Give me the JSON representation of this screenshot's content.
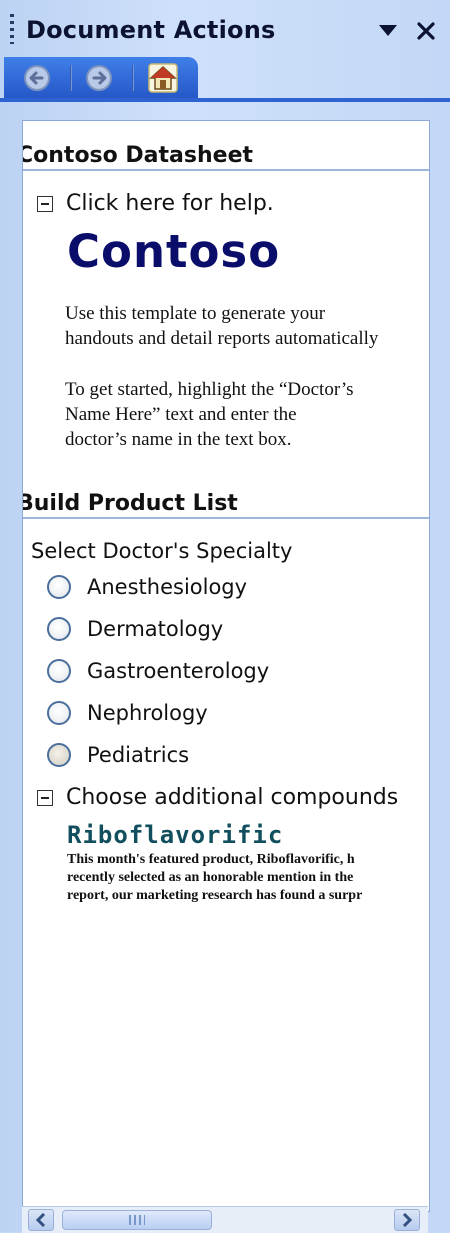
{
  "pane": {
    "title": "Document Actions",
    "icons": {
      "dropdown": "dropdown-arrow-icon",
      "close": "close-icon"
    }
  },
  "toolbar": {
    "buttons": [
      {
        "name": "back",
        "icon": "back-arrow-icon"
      },
      {
        "name": "forward",
        "icon": "forward-arrow-icon"
      },
      {
        "name": "home",
        "icon": "home-icon"
      }
    ]
  },
  "sections": {
    "datasheet": {
      "heading": "Contoso Datasheet",
      "help_toggle": "Click here for help.",
      "logo_text": "Contoso",
      "paragraph1": [
        "Use this template to generate your",
        "handouts and detail reports automatically"
      ],
      "paragraph2": [
        "To get started, highlight the “Doctor’s",
        "Name Here” text and enter the",
        "doctor’s name in the text box."
      ]
    },
    "product_list": {
      "heading": "Build Product List",
      "prompt": "Select Doctor's Specialty",
      "specialties": [
        "Anesthesiology",
        "Dermatology",
        "Gastroenterology",
        "Nephrology",
        "Pediatrics"
      ],
      "compounds_toggle": "Choose additional compounds",
      "featured_product": {
        "name": "Riboflavorific",
        "description": [
          "This month's featured product, Riboflavorific, h",
          "recently selected as an honorable mention in the",
          "report, our marketing research has found a surpr"
        ]
      }
    }
  },
  "colors": {
    "pane_background": "#c4d9f7",
    "toolbar_blue": "#2e63d1",
    "logo_navy": "#0b0d6a",
    "product_teal": "#124f5e"
  }
}
